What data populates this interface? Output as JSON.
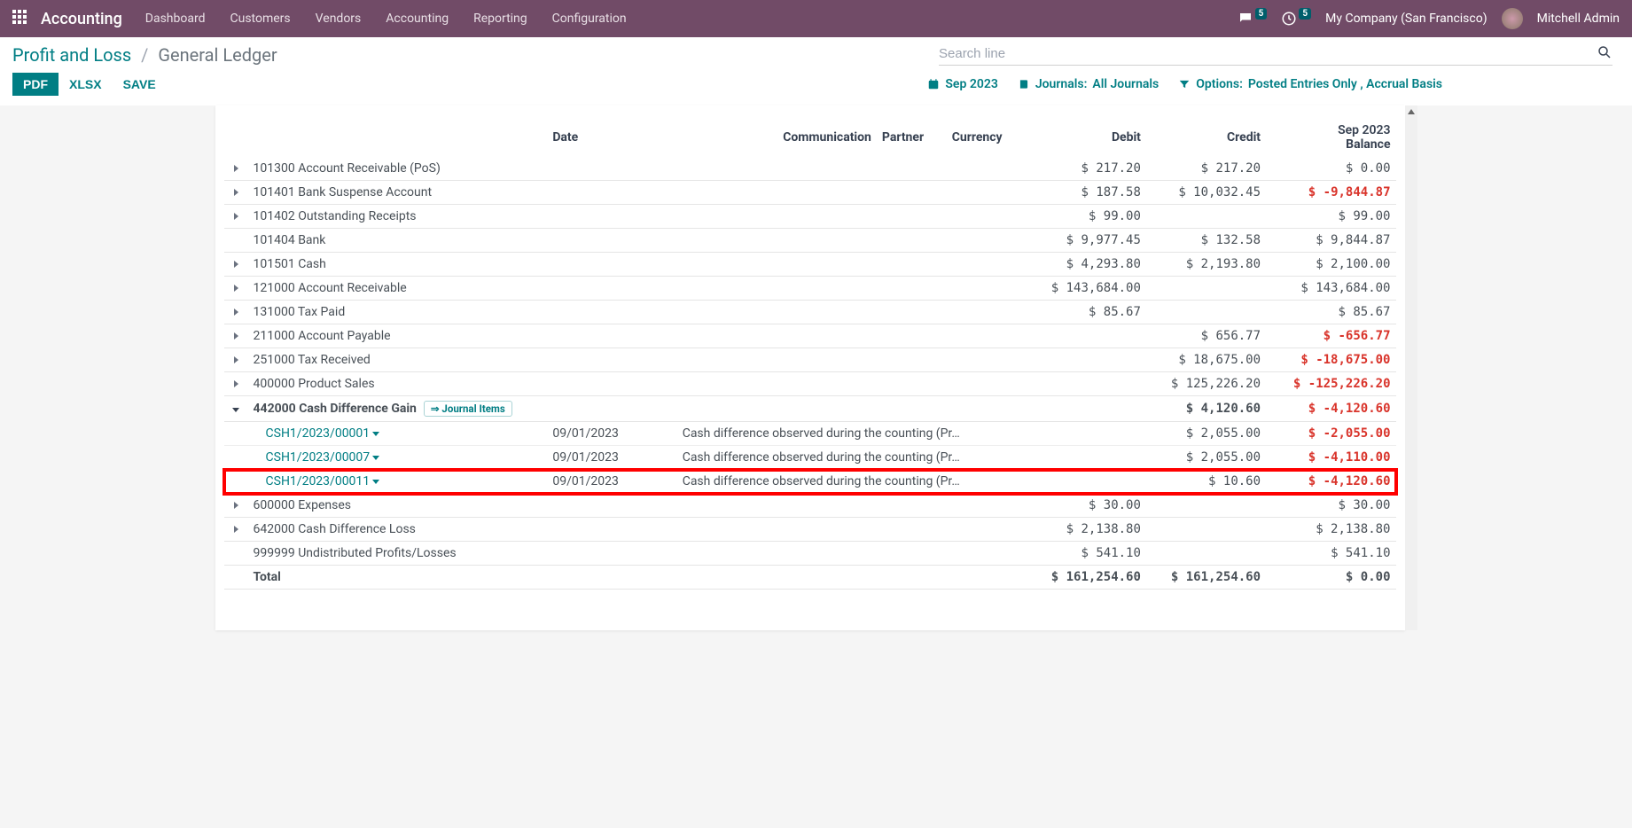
{
  "topbar": {
    "app_title": "Accounting",
    "menu": [
      "Dashboard",
      "Customers",
      "Vendors",
      "Accounting",
      "Reporting",
      "Configuration"
    ],
    "msg_count": "5",
    "clock_count": "5",
    "company": "My Company (San Francisco)",
    "user": "Mitchell Admin"
  },
  "breadcrumb": {
    "root": "Profit and Loss",
    "current": "General Ledger"
  },
  "search": {
    "placeholder": "Search line"
  },
  "actions": {
    "pdf": "PDF",
    "xlsx": "XLSX",
    "save": "SAVE"
  },
  "filters": {
    "date": "Sep 2023",
    "journals_label": "Journals:",
    "journals_value": "All Journals",
    "options_label": "Options:",
    "options_value": "Posted Entries Only , Accrual Basis"
  },
  "columns": {
    "date": "Date",
    "communication": "Communication",
    "partner": "Partner",
    "currency": "Currency",
    "debit": "Debit",
    "credit": "Credit",
    "period": "Sep 2023",
    "balance": "Balance"
  },
  "rows": [
    {
      "caret": "right",
      "name": "101300 Account Receivable (PoS)",
      "debit": "$ 217.20",
      "credit": "$ 217.20",
      "balance": "$ 0.00"
    },
    {
      "caret": "right",
      "name": "101401 Bank Suspense Account",
      "debit": "$ 187.58",
      "credit": "$ 10,032.45",
      "balance": "$ -9,844.87",
      "neg": true
    },
    {
      "caret": "right",
      "name": "101402 Outstanding Receipts",
      "debit": "$ 99.00",
      "credit": "",
      "balance": "$ 99.00"
    },
    {
      "caret": "",
      "name": "101404 Bank",
      "debit": "$ 9,977.45",
      "credit": "$ 132.58",
      "balance": "$ 9,844.87"
    },
    {
      "caret": "right",
      "name": "101501 Cash",
      "debit": "$ 4,293.80",
      "credit": "$ 2,193.80",
      "balance": "$ 2,100.00"
    },
    {
      "caret": "right",
      "name": "121000 Account Receivable",
      "debit": "$ 143,684.00",
      "credit": "",
      "balance": "$ 143,684.00"
    },
    {
      "caret": "right",
      "name": "131000 Tax Paid",
      "debit": "$ 85.67",
      "credit": "",
      "balance": "$ 85.67"
    },
    {
      "caret": "right",
      "name": "211000 Account Payable",
      "debit": "",
      "credit": "$ 656.77",
      "balance": "$ -656.77",
      "neg": true
    },
    {
      "caret": "right",
      "name": "251000 Tax Received",
      "debit": "",
      "credit": "$ 18,675.00",
      "balance": "$ -18,675.00",
      "neg": true
    },
    {
      "caret": "right",
      "name": "400000 Product Sales",
      "debit": "",
      "credit": "$ 125,226.20",
      "balance": "$ -125,226.20",
      "neg": true
    }
  ],
  "expanded": {
    "name": "442000 Cash Difference Gain",
    "badge": "⇒ Journal Items",
    "debit": "",
    "credit": "$ 4,120.60",
    "balance": "$ -4,120.60",
    "children": [
      {
        "ref": "CSH1/2023/00001",
        "date": "09/01/2023",
        "comm": "Cash difference observed during the counting (Pr…",
        "credit": "$ 2,055.00",
        "balance": "$ -2,055.00"
      },
      {
        "ref": "CSH1/2023/00007",
        "date": "09/01/2023",
        "comm": "Cash difference observed during the counting (Pr…",
        "credit": "$ 2,055.00",
        "balance": "$ -4,110.00"
      },
      {
        "ref": "CSH1/2023/00011",
        "date": "09/01/2023",
        "comm": "Cash difference observed during the counting (Pr…",
        "credit": "$ 10.60",
        "balance": "$ -4,120.60",
        "highlight": true
      }
    ]
  },
  "rows_after": [
    {
      "caret": "right",
      "name": "600000 Expenses",
      "debit": "$ 30.00",
      "credit": "",
      "balance": "$ 30.00"
    },
    {
      "caret": "right",
      "name": "642000 Cash Difference Loss",
      "debit": "$ 2,138.80",
      "credit": "",
      "balance": "$ 2,138.80"
    },
    {
      "caret": "",
      "name": "999999 Undistributed Profits/Losses",
      "debit": "$ 541.10",
      "credit": "",
      "balance": "$ 541.10"
    }
  ],
  "total": {
    "label": "Total",
    "debit": "$ 161,254.60",
    "credit": "$ 161,254.60",
    "balance": "$ 0.00"
  }
}
